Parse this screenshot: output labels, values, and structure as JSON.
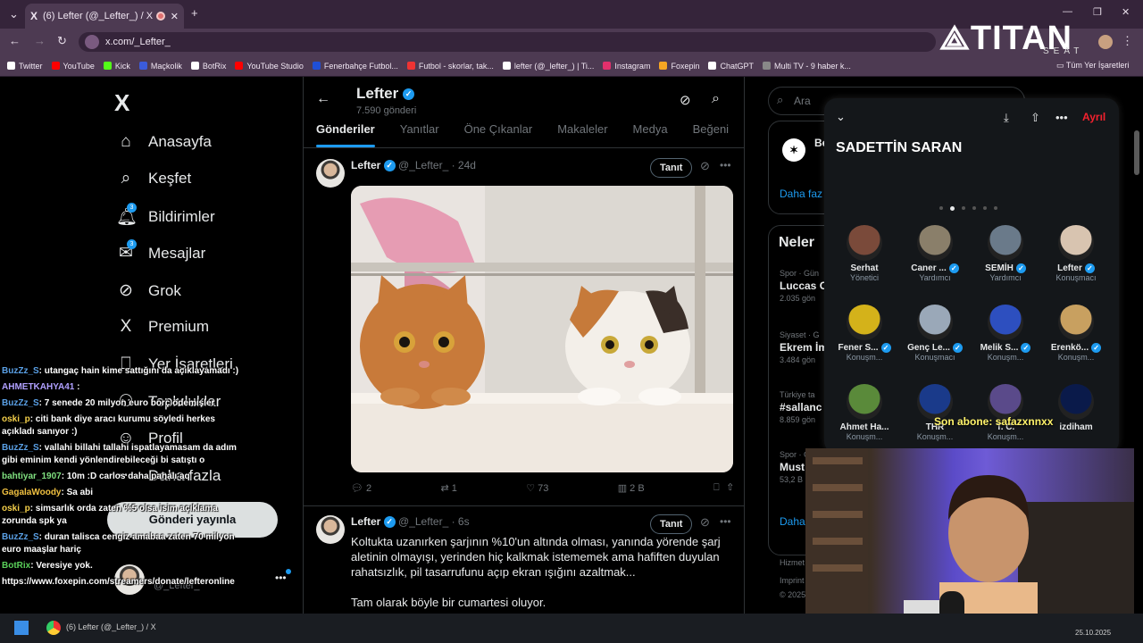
{
  "browser": {
    "tab_title": "(6) Lefter (@_Lefter_) / X",
    "url": "x.com/_Lefter_",
    "bookmarks": [
      {
        "label": "Twitter",
        "color": "#ffffff"
      },
      {
        "label": "YouTube",
        "color": "#ff0000"
      },
      {
        "label": "Kick",
        "color": "#53fc18"
      },
      {
        "label": "Maçkolik",
        "color": "#3b5bdb"
      },
      {
        "label": "BotRix",
        "color": "#ffffff"
      },
      {
        "label": "YouTube Studio",
        "color": "#ff0000"
      },
      {
        "label": "Fenerbahçe Futbol...",
        "color": "#1f4fd6"
      },
      {
        "label": "Futbol - skorlar, tak...",
        "color": "#e33"
      },
      {
        "label": "lefter (@_lefter_) | Ti...",
        "color": "#ffffff"
      },
      {
        "label": "Instagram",
        "color": "#e1306c"
      },
      {
        "label": "Foxepin",
        "color": "#f5a623"
      },
      {
        "label": "ChatGPT",
        "color": "#ffffff"
      },
      {
        "label": "Multi TV - 9 haber k...",
        "color": "#888888"
      }
    ],
    "all_bookmarks": "Tüm Yer İşaretleri"
  },
  "overlay_logo": {
    "text": "TITAN",
    "sub": "SEAT"
  },
  "nav": {
    "items": [
      {
        "label": "Anasayfa",
        "icon": "home-icon",
        "glyph": "⌂"
      },
      {
        "label": "Keşfet",
        "icon": "search-icon",
        "glyph": "⌕"
      },
      {
        "label": "Bildirimler",
        "icon": "bell-icon",
        "glyph": "🔔︎",
        "badge": "3"
      },
      {
        "label": "Mesajlar",
        "icon": "mail-icon",
        "glyph": "✉",
        "badge": "3"
      },
      {
        "label": "Grok",
        "icon": "grok-icon",
        "glyph": "⊘"
      },
      {
        "label": "Premium",
        "icon": "x-icon",
        "glyph": "X"
      },
      {
        "label": "Yer İşaretleri",
        "icon": "bookmark-icon",
        "glyph": "⎕"
      },
      {
        "label": "Topluluklar",
        "icon": "communities-icon",
        "glyph": "⚇"
      },
      {
        "label": "Profil",
        "icon": "profile-icon",
        "glyph": "☺"
      },
      {
        "label": "Daha fazla",
        "icon": "more-icon",
        "glyph": "⋯"
      }
    ],
    "post_button": "Gönderi yayınla",
    "account_handle": "@_Lefter_"
  },
  "profile": {
    "name": "Lefter",
    "post_count": "7.590 gönderi",
    "tabs": [
      "Gönderiler",
      "Yanıtlar",
      "Öne Çıkanlar",
      "Makaleler",
      "Medya",
      "Beğeni"
    ]
  },
  "posts": [
    {
      "name": "Lefter",
      "handle": "@_Lefter_",
      "time": "· 24d",
      "follow": "Tanıt",
      "replies": "2",
      "reposts": "1",
      "likes": "73",
      "views": "2 B"
    },
    {
      "name": "Lefter",
      "handle": "@_Lefter_",
      "time": "· 6s",
      "follow": "Tanıt",
      "text1": "Koltukta uzanırken şarjının %10'un altında olması, yanında yörende şarj aletinin olmayışı, yerinden hiç kalkmak istememek ama hafiften duyulan rahatsızlık, pil tasarrufunu açıp ekran ışığını azaltmak...",
      "text2": "Tam olarak böyle bir cumartesi oluyor."
    }
  ],
  "right": {
    "search_placeholder": "Ara",
    "suggest_name": "Be",
    "show_more": "Daha faz",
    "trends_title": "Neler",
    "trends": [
      {
        "cat": "Spor · Gün",
        "title": "Luccas C",
        "count": "2.035 gön"
      },
      {
        "cat": "Siyaset · G",
        "title": "Ekrem İm",
        "count": "3.484 gön"
      },
      {
        "cat": "Türkiye ta",
        "title": "#sallanc",
        "count": "8.859 gön"
      },
      {
        "cat": "Spor · Gün",
        "title": "Must",
        "count": "53,2 B"
      }
    ],
    "show_more2": "Daha",
    "footer1": "Hizmet",
    "footer2": "Imprint",
    "footer3": "© 2025"
  },
  "space": {
    "title": "SADETTİN SARAN",
    "leave": "Ayrıl",
    "speakers": [
      {
        "name": "Serhat",
        "role": "Yönetici",
        "verified": false,
        "color": "#7a4a3a"
      },
      {
        "name": "Caner ...",
        "role": "Yardımcı",
        "verified": true,
        "color": "#8a7f6a"
      },
      {
        "name": "SEMİH",
        "role": "Yardımcı",
        "verified": true,
        "color": "#6a7a8a"
      },
      {
        "name": "Lefter",
        "role": "Konuşmacı",
        "verified": true,
        "color": "#d8c4b0"
      },
      {
        "name": "Fener S...",
        "role": "Konuşm...",
        "verified": true,
        "color": "#d4b21a"
      },
      {
        "name": "Genç Le...",
        "role": "Konuşmacı",
        "verified": true,
        "color": "#9aa8b8"
      },
      {
        "name": "Melik S...",
        "role": "Konuşm...",
        "verified": true,
        "color": "#2d4fbf"
      },
      {
        "name": "Erenkö...",
        "role": "Konuşm...",
        "verified": true,
        "color": "#c8a060"
      },
      {
        "name": "Ahmet Ha...",
        "role": "Konuşm...",
        "verified": false,
        "color": "#5a8a3a"
      },
      {
        "name": "THR",
        "role": "Konuşm...",
        "verified": false,
        "color": "#1a3a8a"
      },
      {
        "name": "T. C.",
        "role": "Konuşm...",
        "verified": false,
        "color": "#5a4a8a"
      },
      {
        "name": "izdiham",
        "role": "",
        "verified": false,
        "color": "#0a1a4a"
      }
    ]
  },
  "chat": [
    {
      "user": "BuzZz_S",
      "color": "#5aa0e6",
      "text": ": utangaç hain kime sattığını da açıklayamadı :)"
    },
    {
      "user": "AHMETKAHYA41",
      "color": "#b0a0ff",
      "text": " :"
    },
    {
      "user": "BuzZz_S",
      "color": "#5aa0e6",
      "text": ": 7 senede 20 milyon euro borç ödemişler"
    },
    {
      "user": "oski_p",
      "color": "#f5d04a",
      "text": ": citi bank diye aracı kurumu söyledi herkes açıkladı sanıyor :)"
    },
    {
      "user": "BuzZz_S",
      "color": "#5aa0e6",
      "text": ": vallahi billahi tallahi ispatlayamasam da adım gibi eminim kendi yönlendirebileceği bi satıştı o"
    },
    {
      "user": "bahtiyar_1907",
      "color": "#7fe07f",
      "text": ": 10m :D carlos daha pahalı aq"
    },
    {
      "user": "GagalaWoody",
      "color": "#f0c040",
      "text": ": Sa abi"
    },
    {
      "user": "oski_p",
      "color": "#f5d04a",
      "text": ": simsarlık orda zaten %5 olsa isim açıklama zorunda spk ya"
    },
    {
      "user": "BuzZz_S",
      "color": "#5aa0e6",
      "text": ": duran talisca cengiz amabaa zaten 70 milyon euro maaşlar hariç"
    },
    {
      "user": "BotRix",
      "color": "#5ad05a",
      "text": ": Veresiye yok."
    },
    {
      "user": "",
      "color": "#ffffff",
      "text": "https://www.foxepin.com/streamers/donate/lefteronline"
    }
  ],
  "sub_alert": "Son abone: safazxnnxx",
  "taskbar": {
    "window": "(6) Lefter (@_Lefter_) / X",
    "date": "25.10.2025"
  }
}
